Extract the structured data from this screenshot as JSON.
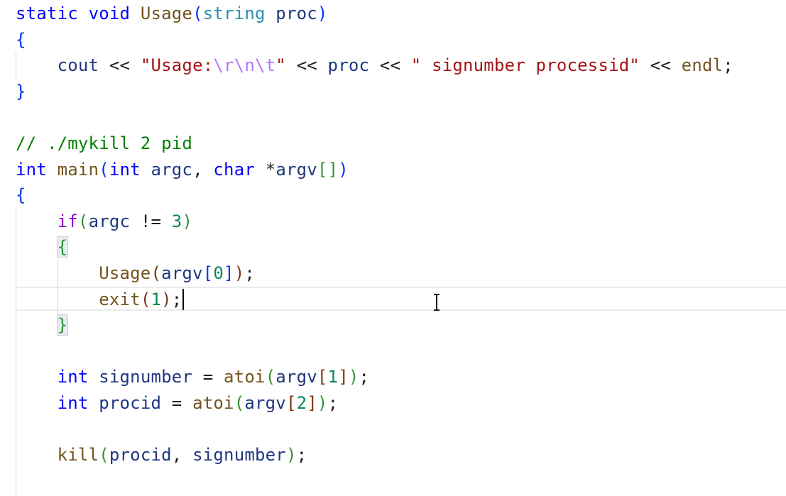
{
  "editor": {
    "language": "C++",
    "colors": {
      "keyword": "#0000ff",
      "type": "#2b91af",
      "function": "#74531f",
      "parameter": "#1f377f",
      "string": "#a31515",
      "escape": "#b776fb",
      "comment": "#008000",
      "number": "#098658",
      "control": "#8f08c4"
    },
    "lines": [
      {
        "tokens": [
          {
            "t": "static",
            "c": "kw"
          },
          {
            "t": " ",
            "c": "pun"
          },
          {
            "t": "void",
            "c": "kw"
          },
          {
            "t": " ",
            "c": "pun"
          },
          {
            "t": "Usage",
            "c": "fn"
          },
          {
            "t": "(",
            "c": "br1"
          },
          {
            "t": "string",
            "c": "ty"
          },
          {
            "t": " ",
            "c": "pun"
          },
          {
            "t": "proc",
            "c": "pm"
          },
          {
            "t": ")",
            "c": "br1"
          }
        ]
      },
      {
        "tokens": [
          {
            "t": "{",
            "c": "br1"
          }
        ]
      },
      {
        "tokens": [
          {
            "t": "    ",
            "c": "pun"
          },
          {
            "t": "cout",
            "c": "pm"
          },
          {
            "t": " << ",
            "c": "op"
          },
          {
            "t": "\"Usage:",
            "c": "str"
          },
          {
            "t": "\\r\\n\\t",
            "c": "esc"
          },
          {
            "t": "\"",
            "c": "str"
          },
          {
            "t": " << ",
            "c": "op"
          },
          {
            "t": "proc",
            "c": "pm"
          },
          {
            "t": " << ",
            "c": "op"
          },
          {
            "t": "\" signumber processid\"",
            "c": "str"
          },
          {
            "t": " << ",
            "c": "op"
          },
          {
            "t": "endl",
            "c": "fn"
          },
          {
            "t": ";",
            "c": "pun"
          }
        ]
      },
      {
        "tokens": [
          {
            "t": "}",
            "c": "br1"
          }
        ]
      },
      {
        "tokens": []
      },
      {
        "tokens": [
          {
            "t": "// ./mykill 2 pid",
            "c": "cmt"
          }
        ]
      },
      {
        "tokens": [
          {
            "t": "int",
            "c": "kw"
          },
          {
            "t": " ",
            "c": "pun"
          },
          {
            "t": "main",
            "c": "fn"
          },
          {
            "t": "(",
            "c": "br1"
          },
          {
            "t": "int",
            "c": "kw"
          },
          {
            "t": " ",
            "c": "pun"
          },
          {
            "t": "argc",
            "c": "pm"
          },
          {
            "t": ", ",
            "c": "pun"
          },
          {
            "t": "char",
            "c": "kw"
          },
          {
            "t": " *",
            "c": "op"
          },
          {
            "t": "argv",
            "c": "pm"
          },
          {
            "t": "[]",
            "c": "br2"
          },
          {
            "t": ")",
            "c": "br1"
          }
        ]
      },
      {
        "tokens": [
          {
            "t": "{",
            "c": "br1"
          }
        ]
      },
      {
        "tokens": [
          {
            "t": "    ",
            "c": "pun"
          },
          {
            "t": "if",
            "c": "ctl"
          },
          {
            "t": "(",
            "c": "br2"
          },
          {
            "t": "argc",
            "c": "pm"
          },
          {
            "t": " != ",
            "c": "op"
          },
          {
            "t": "3",
            "c": "num"
          },
          {
            "t": ")",
            "c": "br2"
          }
        ]
      },
      {
        "tokens": [
          {
            "t": "    ",
            "c": "pun"
          },
          {
            "t": "{",
            "c": "br2",
            "box": true
          }
        ]
      },
      {
        "tokens": [
          {
            "t": "        ",
            "c": "pun"
          },
          {
            "t": "Usage",
            "c": "fn"
          },
          {
            "t": "(",
            "c": "br3"
          },
          {
            "t": "argv",
            "c": "pm"
          },
          {
            "t": "[",
            "c": "br1"
          },
          {
            "t": "0",
            "c": "num"
          },
          {
            "t": "]",
            "c": "br1"
          },
          {
            "t": ")",
            "c": "br3"
          },
          {
            "t": ";",
            "c": "pun"
          }
        ]
      },
      {
        "tokens": [
          {
            "t": "        ",
            "c": "pun"
          },
          {
            "t": "exit",
            "c": "fn"
          },
          {
            "t": "(",
            "c": "br3"
          },
          {
            "t": "1",
            "c": "num"
          },
          {
            "t": ")",
            "c": "br3"
          },
          {
            "t": ";",
            "c": "pun"
          }
        ]
      },
      {
        "tokens": [
          {
            "t": "    ",
            "c": "pun"
          },
          {
            "t": "}",
            "c": "br2",
            "box": true
          }
        ]
      },
      {
        "tokens": []
      },
      {
        "tokens": [
          {
            "t": "    ",
            "c": "pun"
          },
          {
            "t": "int",
            "c": "kw"
          },
          {
            "t": " ",
            "c": "pun"
          },
          {
            "t": "signumber",
            "c": "pm"
          },
          {
            "t": " = ",
            "c": "op"
          },
          {
            "t": "atoi",
            "c": "fn"
          },
          {
            "t": "(",
            "c": "br2"
          },
          {
            "t": "argv",
            "c": "pm"
          },
          {
            "t": "[",
            "c": "br3"
          },
          {
            "t": "1",
            "c": "num"
          },
          {
            "t": "]",
            "c": "br3"
          },
          {
            "t": ")",
            "c": "br2"
          },
          {
            "t": ";",
            "c": "pun"
          }
        ]
      },
      {
        "tokens": [
          {
            "t": "    ",
            "c": "pun"
          },
          {
            "t": "int",
            "c": "kw"
          },
          {
            "t": " ",
            "c": "pun"
          },
          {
            "t": "procid",
            "c": "pm"
          },
          {
            "t": " = ",
            "c": "op"
          },
          {
            "t": "atoi",
            "c": "fn"
          },
          {
            "t": "(",
            "c": "br2"
          },
          {
            "t": "argv",
            "c": "pm"
          },
          {
            "t": "[",
            "c": "br3"
          },
          {
            "t": "2",
            "c": "num"
          },
          {
            "t": "]",
            "c": "br3"
          },
          {
            "t": ")",
            "c": "br2"
          },
          {
            "t": ";",
            "c": "pun"
          }
        ]
      },
      {
        "tokens": []
      },
      {
        "tokens": [
          {
            "t": "    ",
            "c": "pun"
          },
          {
            "t": "kill",
            "c": "fn"
          },
          {
            "t": "(",
            "c": "br2"
          },
          {
            "t": "procid",
            "c": "pm"
          },
          {
            "t": ", ",
            "c": "pun"
          },
          {
            "t": "signumber",
            "c": "pm"
          },
          {
            "t": ")",
            "c": "br2"
          },
          {
            "t": ";",
            "c": "pun"
          }
        ]
      }
    ],
    "caret_line": 12,
    "mouse_cursor_icon": "text-ibeam-cursor-icon"
  }
}
